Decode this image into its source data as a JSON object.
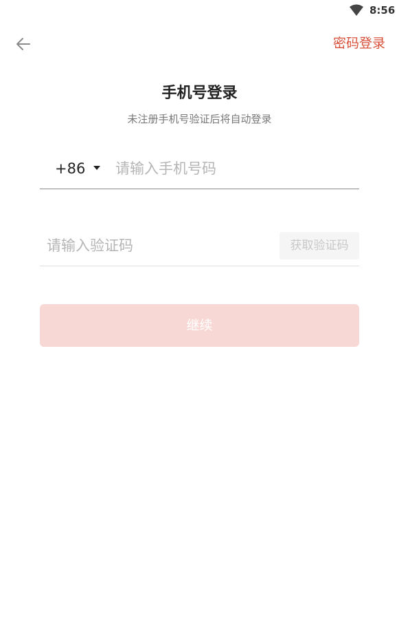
{
  "status_bar": {
    "time": "8:56",
    "wifi_icon": "wifi-icon"
  },
  "nav": {
    "back_icon": "arrow-left-icon",
    "password_login_label": "密码登录"
  },
  "header": {
    "title": "手机号登录",
    "subtitle": "未注册手机号验证后将自动登录"
  },
  "phone": {
    "country_code": "+86",
    "caret_icon": "caret-down-icon",
    "value": "",
    "placeholder": "请输入手机号码"
  },
  "code": {
    "value": "",
    "placeholder": "请输入验证码",
    "get_code_label": "获取验证码"
  },
  "continue_label": "继续",
  "colors": {
    "accent": "#d9503a",
    "button_disabled": "#f7d8d4",
    "placeholder": "#b5b5b5"
  }
}
